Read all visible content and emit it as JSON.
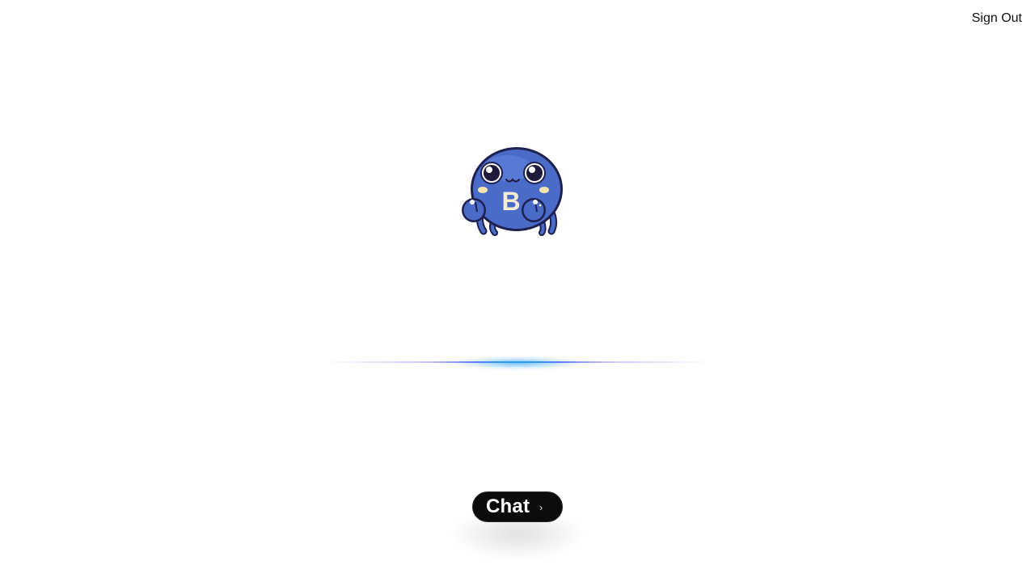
{
  "header": {
    "sign_out_label": "Sign Out"
  },
  "hero": {
    "mascot_icon": "crab-mascot-icon",
    "mascot_letter": "B"
  },
  "cta": {
    "chat_label": "Chat",
    "arrow_glyph": "›",
    "arrow_icon": "chevron-right-icon"
  },
  "colors": {
    "background": "#ffffff",
    "button_bg": "#0b0b0b",
    "mascot_blue": "#4a6cc8",
    "glow_blue": "#28a0ff"
  }
}
